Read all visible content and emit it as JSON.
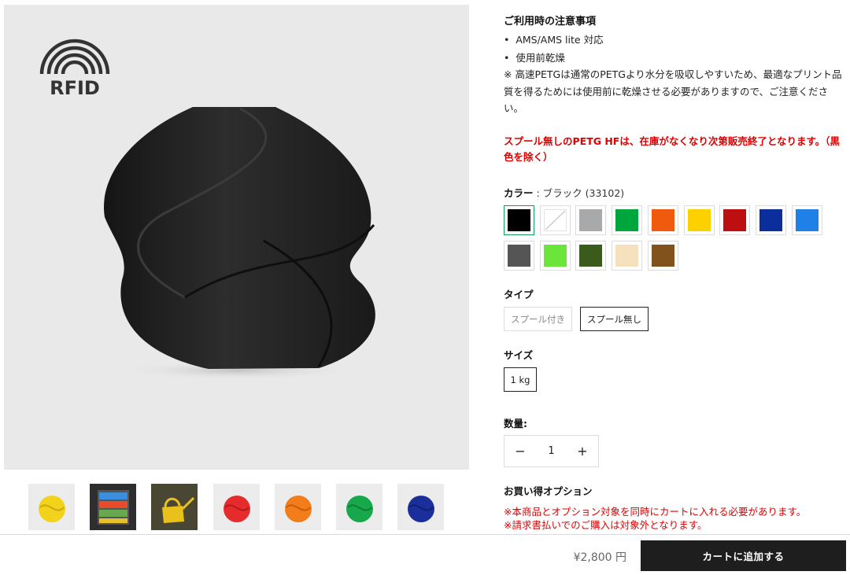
{
  "gallery": {
    "rfid_text": "RFID",
    "thumbnails": [
      {
        "name": "yellow-vase",
        "color": "#f2d21b"
      },
      {
        "name": "drawer-print",
        "color": "#3a3a3a"
      },
      {
        "name": "watering-can",
        "color": "#e8c21a"
      },
      {
        "name": "red-vase",
        "color": "#e52b2b"
      },
      {
        "name": "orange-vase",
        "color": "#f37c1b"
      },
      {
        "name": "green-vase",
        "color": "#16a84a"
      },
      {
        "name": "blue-vase",
        "color": "#1b2f9c"
      }
    ]
  },
  "notice": {
    "title": "ご利用時の注意事項",
    "bullets": [
      "AMS/AMS lite 対応",
      "使用前乾燥"
    ],
    "note": "※ 高速PETGは通常のPETGより水分を吸収しやすいため、最適なプリント品質を得るためには使用前に乾燥させる必要がありますので、ご注意ください。",
    "warning": "スプール無しのPETG HFは、在庫がなくなり次第販売終了となります。（黒色を除く）"
  },
  "color": {
    "label": "カラー",
    "value": " : ブラック (33102)",
    "swatches": [
      "#000000",
      "#ffffff",
      "#a7a9ab",
      "#00a63c",
      "#f05a0e",
      "#fdd000",
      "#bd0f0f",
      "#0a2f9c",
      "#1f80e7",
      "#555555",
      "#6be53a",
      "#3a5b1c",
      "#f6e1be",
      "#82521d"
    ]
  },
  "type": {
    "label": "タイプ",
    "options": [
      "スプール付き",
      "スプール無し"
    ],
    "selected": "スプール無し"
  },
  "size": {
    "label": "サイズ",
    "options": [
      "1 kg"
    ]
  },
  "quantity": {
    "label": "数量:",
    "value": "1",
    "minus": "−",
    "plus": "+"
  },
  "bundle": {
    "title": "お買い得オプション",
    "notes": [
      "※本商品とオプション対象を同時にカートに入れる必要があります。",
      "※請求書払いでのご購入は対象外となります。"
    ]
  },
  "bottom": {
    "price": "¥2,800 円",
    "cart_label": "カートに追加する"
  }
}
